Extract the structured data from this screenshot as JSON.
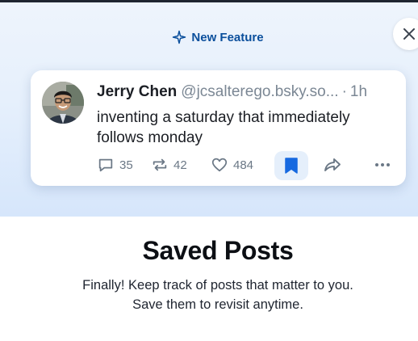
{
  "badge": {
    "icon": "sparkle-icon",
    "label": "New Feature"
  },
  "close_button": {
    "icon": "close-icon"
  },
  "post": {
    "author_name": "Jerry Chen",
    "author_handle": "@jcsalterego.bsky.so...",
    "separator": "·",
    "time": "1h",
    "text_line1": "inventing a saturday that immediately",
    "text_line2": "follows monday",
    "actions": {
      "reply_count": "35",
      "repost_count": "42",
      "like_count": "484",
      "bookmark_active": true
    }
  },
  "modal": {
    "title": "Saved Posts",
    "description_line1": "Finally! Keep track of posts that matter to you.",
    "description_line2": "Save them to revisit anytime."
  },
  "colors": {
    "accent": "#0b4f9c",
    "bookmark": "#1669e0",
    "muted": "#6b7886"
  }
}
